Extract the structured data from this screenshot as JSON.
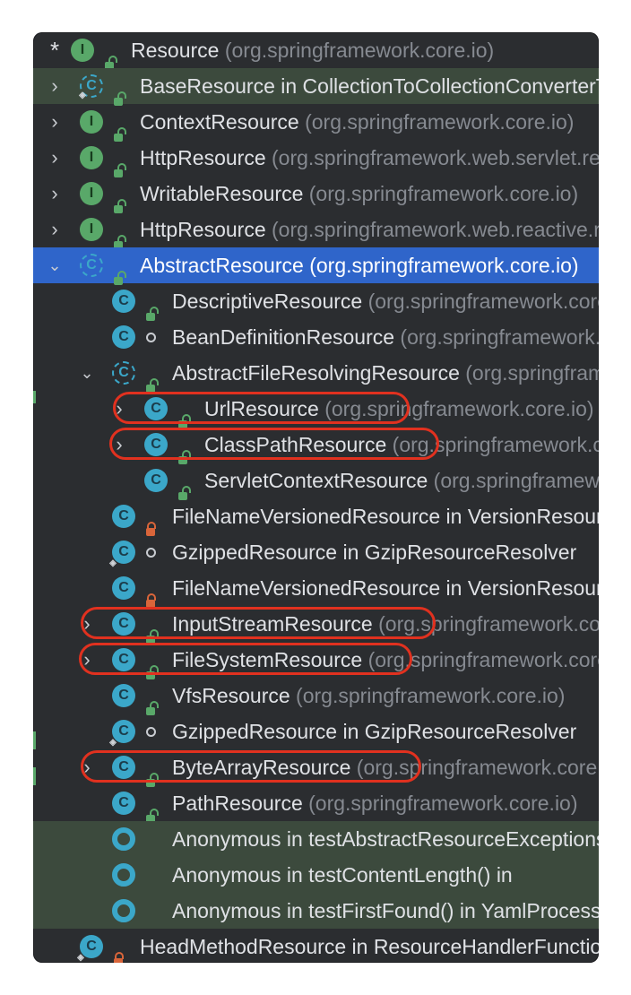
{
  "header": {
    "marker": "*",
    "name": "Resource",
    "pkg": "(org.springframework.core.io)"
  },
  "colors": {
    "selected": "#2f65ca",
    "highlight": "#3c4a3d",
    "annotation": "#e1311f"
  },
  "rows": [
    {
      "name": "BaseResource in CollectionToCollectionConverterTests",
      "pkg": ""
    },
    {
      "name": "ContextResource",
      "pkg": " (org.springframework.core.io)"
    },
    {
      "name": "HttpResource",
      "pkg": " (org.springframework.web.servlet.resource)"
    },
    {
      "name": "WritableResource",
      "pkg": " (org.springframework.core.io)"
    },
    {
      "name": "HttpResource",
      "pkg": " (org.springframework.web.reactive.resource)"
    },
    {
      "name": "AbstractResource",
      "pkg": " (org.springframework.core.io)"
    },
    {
      "name": "DescriptiveResource",
      "pkg": " (org.springframework.core.io)"
    },
    {
      "name": "BeanDefinitionResource",
      "pkg": " (org.springframework.beans.factory.support)"
    },
    {
      "name": "AbstractFileResolvingResource",
      "pkg": " (org.springframework.core.io)"
    },
    {
      "name": "UrlResource",
      "pkg": " (org.springframework.core.io)"
    },
    {
      "name": "ClassPathResource",
      "pkg": " (org.springframework.core.io)"
    },
    {
      "name": "ServletContextResource",
      "pkg": " (org.springframework.web.context.support)"
    },
    {
      "name": "FileNameVersionedResource in VersionResourceResolver",
      "pkg": ""
    },
    {
      "name": "GzippedResource in GzipResourceResolver",
      "pkg": ""
    },
    {
      "name": "FileNameVersionedResource in VersionResourceResolver",
      "pkg": ""
    },
    {
      "name": "InputStreamResource",
      "pkg": " (org.springframework.core.io)"
    },
    {
      "name": "FileSystemResource",
      "pkg": " (org.springframework.core.io)"
    },
    {
      "name": "VfsResource",
      "pkg": " (org.springframework.core.io)"
    },
    {
      "name": "GzippedResource in GzipResourceResolver",
      "pkg": ""
    },
    {
      "name": "ByteArrayResource",
      "pkg": " (org.springframework.core.io)"
    },
    {
      "name": "PathResource",
      "pkg": " (org.springframework.core.io)"
    },
    {
      "name": "Anonymous in testAbstractResourceExceptions()",
      "pkg": ""
    },
    {
      "name": "Anonymous in testContentLength() in",
      "pkg": ""
    },
    {
      "name": "Anonymous in testFirstFound() in YamlProcessorTests",
      "pkg": ""
    },
    {
      "name": "HeadMethodResource in ResourceHandlerFunction",
      "pkg": ""
    }
  ],
  "icons": {
    "class": "C",
    "interface": "I"
  }
}
